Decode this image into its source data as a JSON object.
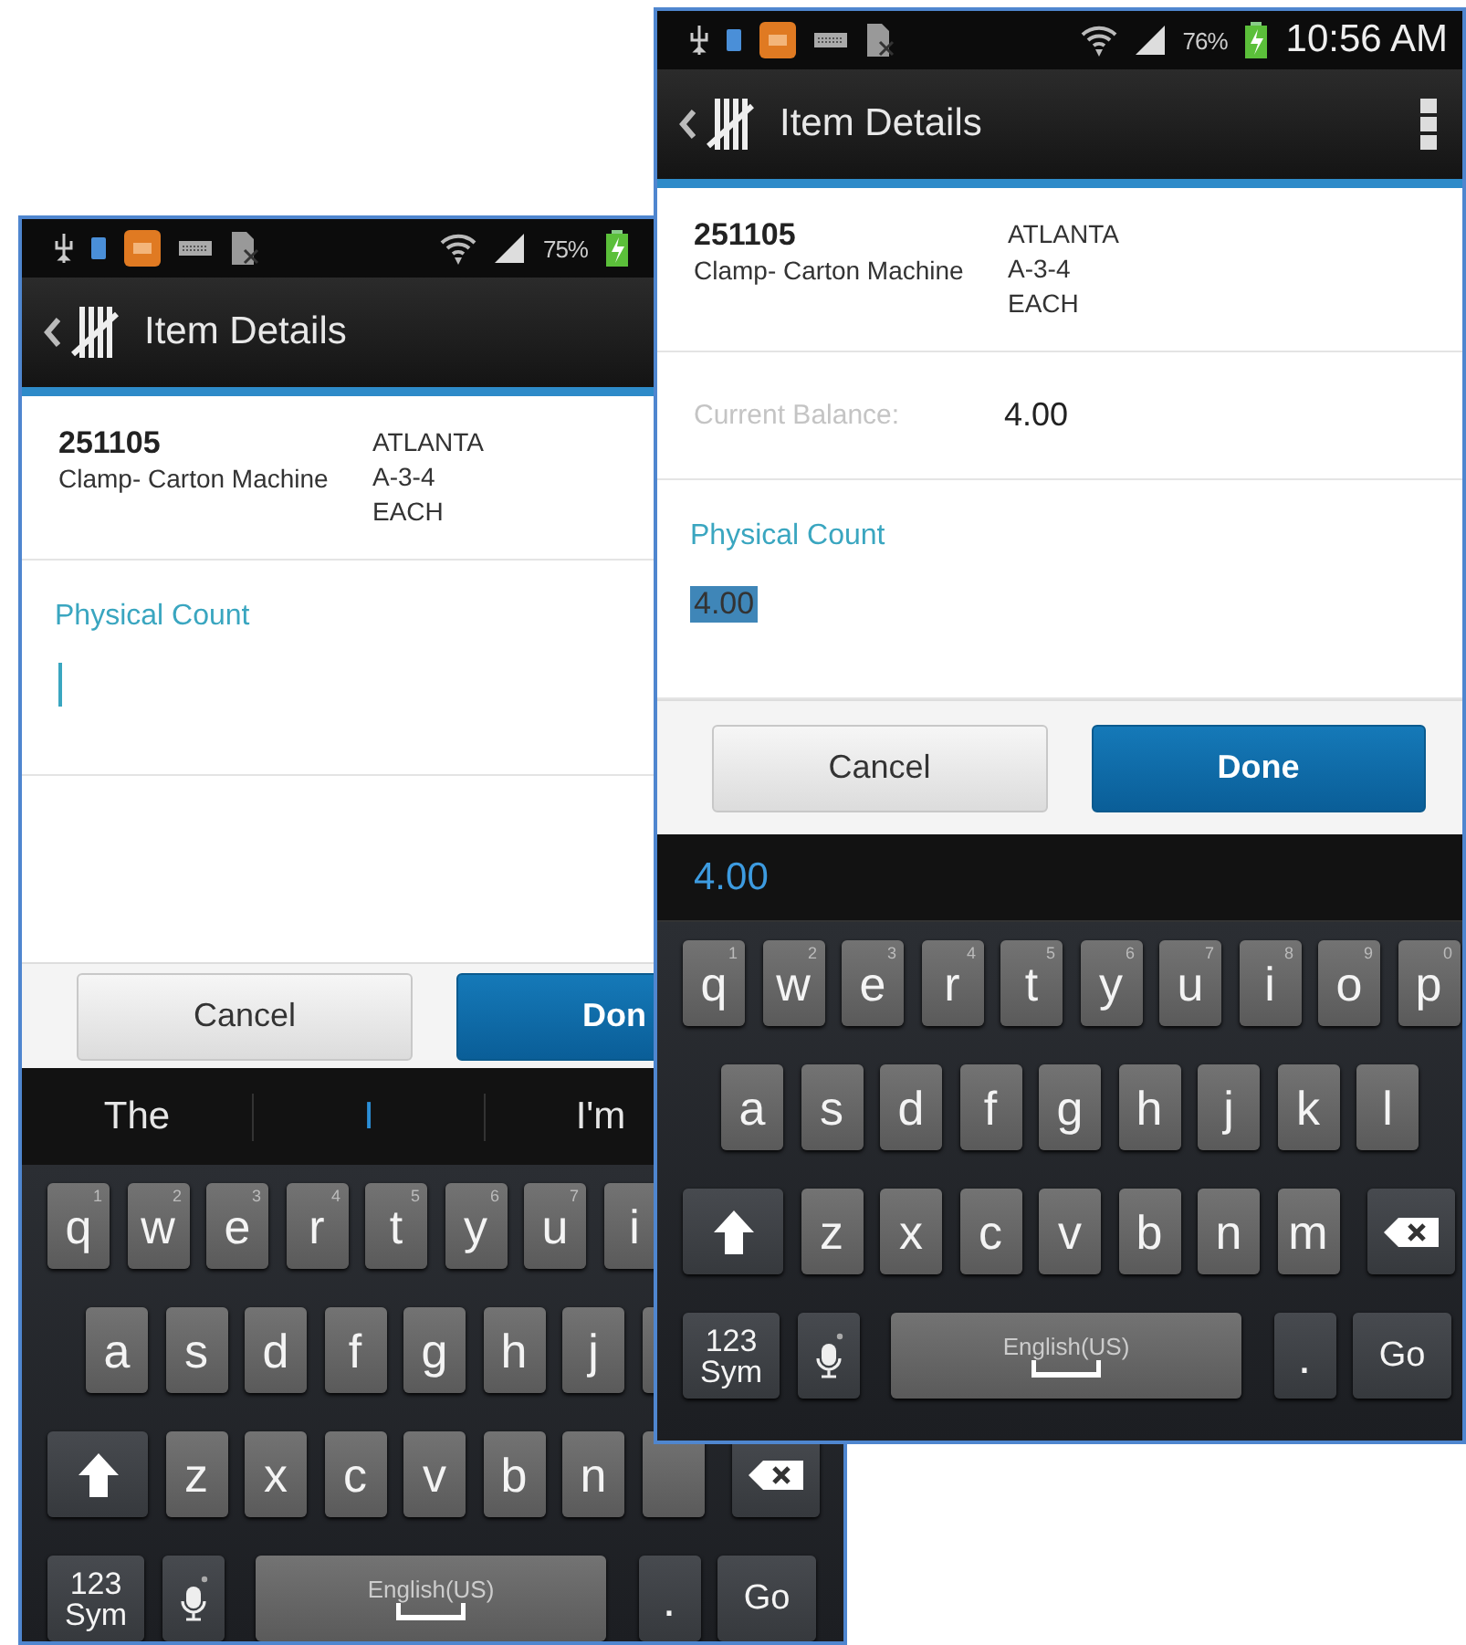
{
  "phones": [
    {
      "status_bar": {
        "battery": "75%"
      },
      "header": {
        "title": "Item Details"
      },
      "item": {
        "number": "251105",
        "description": "Clamp- Carton Machine",
        "details": [
          "ATLANTA",
          "A-3-4",
          "EACH"
        ]
      },
      "physical_count": {
        "label": "Physical Count",
        "cursor": true
      },
      "buttons": [
        {
          "label": "Cancel",
          "kind": "secondary"
        },
        {
          "label": "Don",
          "kind": "primary"
        }
      ],
      "suggestions": [
        {
          "text": "The",
          "selected": false
        },
        {
          "text": "I",
          "selected": true
        },
        {
          "text": "I'm",
          "selected": false
        }
      ],
      "keyboard": [
        [
          {
            "kind": "letter",
            "label": "q",
            "hint": "1"
          },
          {
            "kind": "letter",
            "label": "w",
            "hint": "2"
          },
          {
            "kind": "letter",
            "label": "e",
            "hint": "3"
          },
          {
            "kind": "letter",
            "label": "r",
            "hint": "4"
          },
          {
            "kind": "letter",
            "label": "t",
            "hint": "5"
          },
          {
            "kind": "letter",
            "label": "y",
            "hint": "6"
          },
          {
            "kind": "letter",
            "label": "u",
            "hint": "7"
          },
          {
            "kind": "letter",
            "label": "i"
          }
        ],
        [
          {
            "kind": "letter",
            "label": "a"
          },
          {
            "kind": "letter",
            "label": "s"
          },
          {
            "kind": "letter",
            "label": "d"
          },
          {
            "kind": "letter",
            "label": "f"
          },
          {
            "kind": "letter",
            "label": "g"
          },
          {
            "kind": "letter",
            "label": "h"
          },
          {
            "kind": "letter",
            "label": "j"
          },
          {
            "kind": "blank"
          }
        ],
        [
          {
            "kind": "shift"
          },
          {
            "kind": "letter",
            "label": "z"
          },
          {
            "kind": "letter",
            "label": "x"
          },
          {
            "kind": "letter",
            "label": "c"
          },
          {
            "kind": "letter",
            "label": "v"
          },
          {
            "kind": "letter",
            "label": "b"
          },
          {
            "kind": "letter",
            "label": "n"
          },
          {
            "kind": "blank"
          },
          {
            "kind": "delete"
          }
        ],
        [
          {
            "kind": "sym",
            "label": "123",
            "sublabel": "Sym"
          },
          {
            "kind": "mic"
          },
          {
            "kind": "space",
            "label": "English(US)"
          },
          {
            "kind": "period",
            "label": "."
          },
          {
            "kind": "go",
            "label": "Go"
          }
        ]
      ]
    },
    {
      "status_bar": {
        "battery": "76%",
        "time": "10:56 AM"
      },
      "header": {
        "title": "Item Details",
        "menu": true
      },
      "item": {
        "number": "251105",
        "description": "Clamp- Carton Machine",
        "details": [
          "ATLANTA",
          "A-3-4",
          "EACH"
        ]
      },
      "balance": {
        "label": "Current Balance:",
        "value": "4.00"
      },
      "physical_count": {
        "label": "Physical Count",
        "value": "4.00",
        "text_selected": true,
        "cursor": false
      },
      "buttons": [
        {
          "label": "Cancel",
          "kind": "secondary"
        },
        {
          "label": "Done",
          "kind": "primary"
        }
      ],
      "candidate": "4.00",
      "keyboard": [
        [
          {
            "kind": "letter",
            "label": "q",
            "hint": "1"
          },
          {
            "kind": "letter",
            "label": "w",
            "hint": "2"
          },
          {
            "kind": "letter",
            "label": "e",
            "hint": "3"
          },
          {
            "kind": "letter",
            "label": "r",
            "hint": "4"
          },
          {
            "kind": "letter",
            "label": "t",
            "hint": "5"
          },
          {
            "kind": "letter",
            "label": "y",
            "hint": "6"
          },
          {
            "kind": "letter",
            "label": "u",
            "hint": "7"
          },
          {
            "kind": "letter",
            "label": "i",
            "hint": "8"
          },
          {
            "kind": "letter",
            "label": "o",
            "hint": "9"
          },
          {
            "kind": "letter",
            "label": "p",
            "hint": "0"
          }
        ],
        [
          {
            "kind": "letter",
            "label": "a"
          },
          {
            "kind": "letter",
            "label": "s"
          },
          {
            "kind": "letter",
            "label": "d"
          },
          {
            "kind": "letter",
            "label": "f"
          },
          {
            "kind": "letter",
            "label": "g"
          },
          {
            "kind": "letter",
            "label": "h"
          },
          {
            "kind": "letter",
            "label": "j"
          },
          {
            "kind": "letter",
            "label": "k"
          },
          {
            "kind": "letter",
            "label": "l"
          }
        ],
        [
          {
            "kind": "shift"
          },
          {
            "kind": "letter",
            "label": "z"
          },
          {
            "kind": "letter",
            "label": "x"
          },
          {
            "kind": "letter",
            "label": "c"
          },
          {
            "kind": "letter",
            "label": "v"
          },
          {
            "kind": "letter",
            "label": "b"
          },
          {
            "kind": "letter",
            "label": "n"
          },
          {
            "kind": "letter",
            "label": "m"
          },
          {
            "kind": "delete"
          }
        ],
        [
          {
            "kind": "sym",
            "label": "123",
            "sublabel": "Sym"
          },
          {
            "kind": "mic"
          },
          {
            "kind": "space",
            "label": "English(US)"
          },
          {
            "kind": "period",
            "label": "."
          },
          {
            "kind": "go",
            "label": "Go"
          }
        ]
      ]
    }
  ]
}
